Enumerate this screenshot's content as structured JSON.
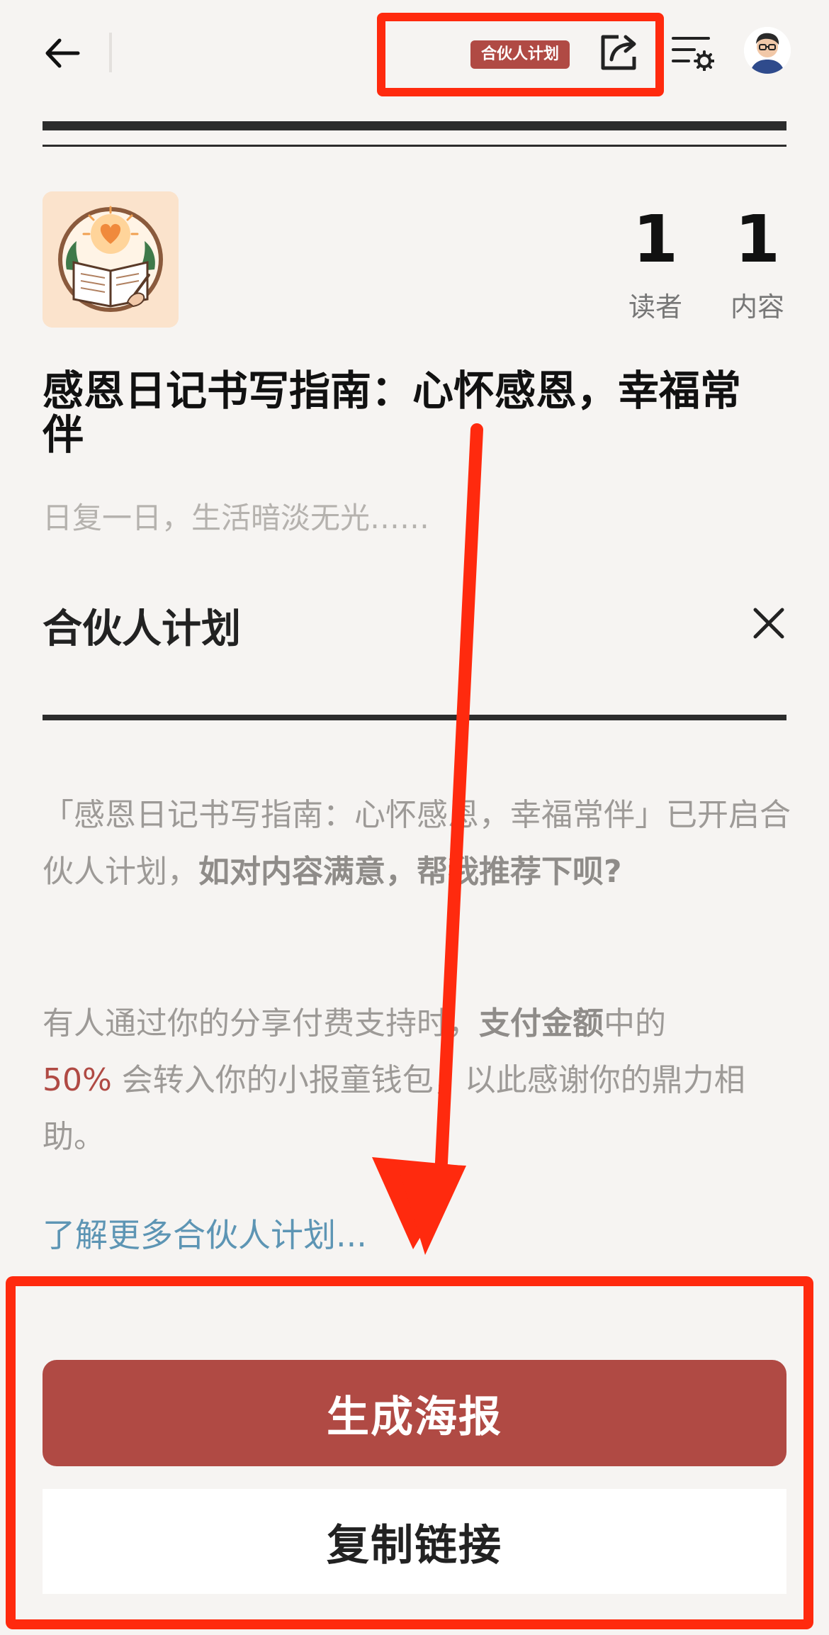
{
  "header": {
    "partner_badge": "合伙人计划",
    "icons": [
      "back-arrow-icon",
      "share-icon",
      "settings-icon",
      "avatar"
    ]
  },
  "stats": {
    "readers_count": "1",
    "readers_label": "读者",
    "contents_count": "1",
    "contents_label": "内容"
  },
  "article": {
    "title": "感恩日记书写指南：心怀感恩，幸福常伴",
    "subtitle": "日复一日，生活暗淡无光……"
  },
  "partner": {
    "section_title": "合伙人计划",
    "para1_prefix": "「感恩日记书写指南：心怀感恩，幸福常伴」已开启合伙人计划，",
    "para1_bold": "如对内容满意，帮我推荐下呗?",
    "para2_part1": "有人通过你的分享付费支持时，",
    "para2_bold": "支付金额",
    "para2_part2": "中的",
    "para2_percent": "50%",
    "para2_part3": " 会转入你的小报童钱包，以此感谢你的鼎力相助。",
    "learn_more": "了解更多合伙人计划..."
  },
  "actions": {
    "generate_poster": "生成海报",
    "copy_link": "复制链接"
  },
  "colors": {
    "accent": "#b04a44",
    "link": "#5d95b4",
    "annotation": "#ff2a0e",
    "background": "#f6f4f2"
  }
}
